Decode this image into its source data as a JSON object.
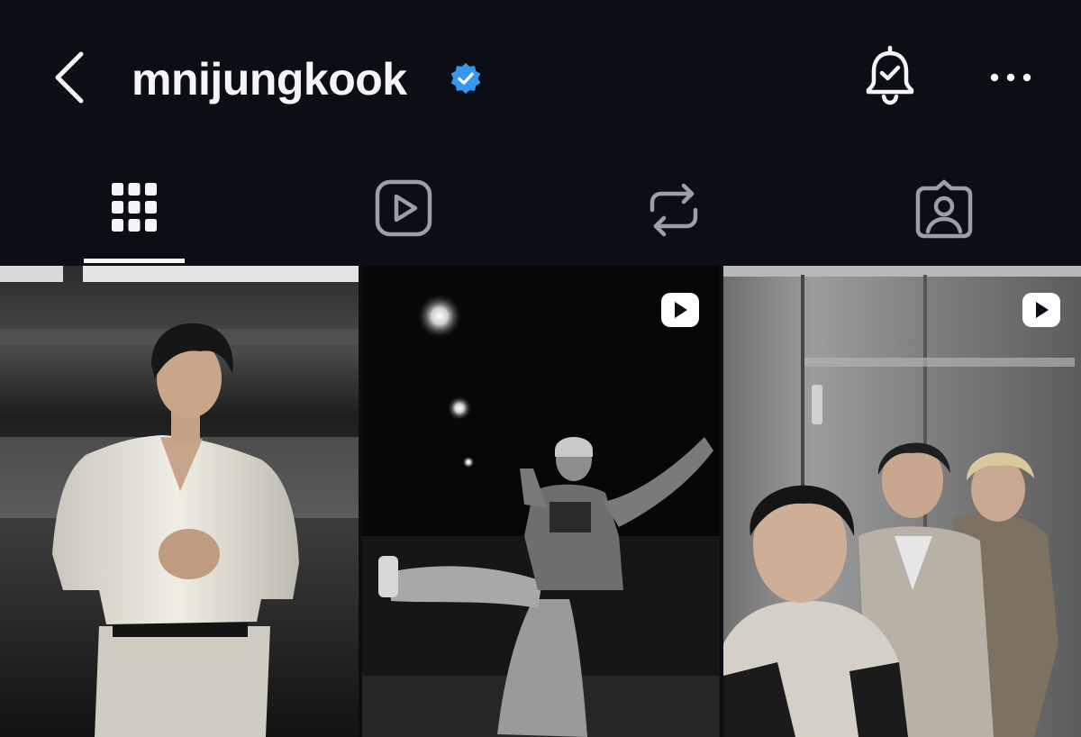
{
  "profile": {
    "username": "mnijungkook",
    "verified": true
  },
  "header": {
    "back_icon": "chevron-left-icon",
    "notification_icon": "bell-check-icon",
    "more_icon": "more-horizontal-icon"
  },
  "tabs": [
    {
      "name": "posts",
      "icon": "grid-icon",
      "active": true
    },
    {
      "name": "reels",
      "icon": "reels-play-icon",
      "active": false
    },
    {
      "name": "reposts",
      "icon": "repost-icon",
      "active": false
    },
    {
      "name": "tagged",
      "icon": "tagged-person-icon",
      "active": false
    }
  ],
  "posts": [
    {
      "type": "photo",
      "reel_badge": false
    },
    {
      "type": "reel",
      "reel_badge": true
    },
    {
      "type": "reel",
      "reel_badge": true
    }
  ],
  "colors": {
    "background": "#0b0e15",
    "text": "#f5f5f5",
    "verified_blue": "#3797f0",
    "inactive_icon": "#9aa0a8"
  }
}
